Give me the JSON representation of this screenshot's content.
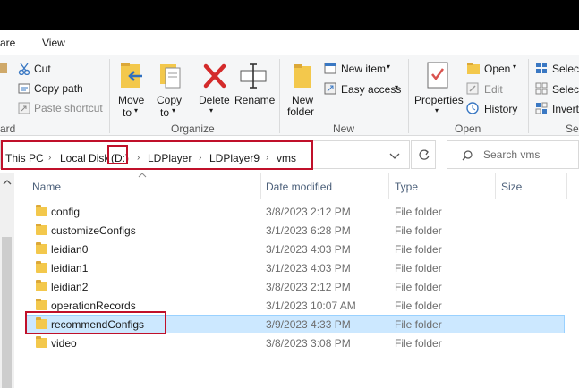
{
  "menu": {
    "share_partial": "are",
    "view": "View"
  },
  "ribbon": {
    "clipboard": {
      "cut": "Cut",
      "copy_path": "Copy path",
      "paste_shortcut": "Paste shortcut",
      "group_label_partial": "ard"
    },
    "organize": {
      "move_to_line1": "Move",
      "move_to_line2": "to",
      "copy_to_line1": "Copy",
      "copy_to_line2": "to",
      "delete": "Delete",
      "rename": "Rename",
      "group_label": "Organize"
    },
    "new": {
      "new_folder_line1": "New",
      "new_folder_line2": "folder",
      "new_item": "New item",
      "easy_access": "Easy access",
      "group_label": "New"
    },
    "open": {
      "properties": "Properties",
      "open": "Open",
      "edit": "Edit",
      "history": "History",
      "group_label": "Open"
    },
    "select": {
      "select_all_partial": "Select",
      "select_none_partial": "Select",
      "invert_partial": "Invert",
      "group_label_partial": "Sel"
    }
  },
  "address": {
    "crumbs": [
      "This PC",
      "Local Disk",
      "(D:)",
      "LDPlayer",
      "LDPlayer9",
      "vms"
    ],
    "search_placeholder": "Search vms"
  },
  "columns": {
    "name": "Name",
    "date": "Date modified",
    "type": "Type",
    "size": "Size"
  },
  "files": [
    {
      "name": "config",
      "date": "3/8/2023 2:12 PM",
      "type": "File folder"
    },
    {
      "name": "customizeConfigs",
      "date": "3/1/2023 6:28 PM",
      "type": "File folder"
    },
    {
      "name": "leidian0",
      "date": "3/1/2023 4:03 PM",
      "type": "File folder"
    },
    {
      "name": "leidian1",
      "date": "3/1/2023 4:03 PM",
      "type": "File folder"
    },
    {
      "name": "leidian2",
      "date": "3/8/2023 2:12 PM",
      "type": "File folder"
    },
    {
      "name": "operationRecords",
      "date": "3/1/2023 10:07 AM",
      "type": "File folder"
    },
    {
      "name": "recommendConfigs",
      "date": "3/9/2023 4:33 PM",
      "type": "File folder",
      "selected": true
    },
    {
      "name": "video",
      "date": "3/8/2023 3:08 PM",
      "type": "File folder"
    }
  ],
  "colors": {
    "selection": "#cce8ff",
    "highlight_box": "#c0102a",
    "folder": "#f3c84c"
  }
}
